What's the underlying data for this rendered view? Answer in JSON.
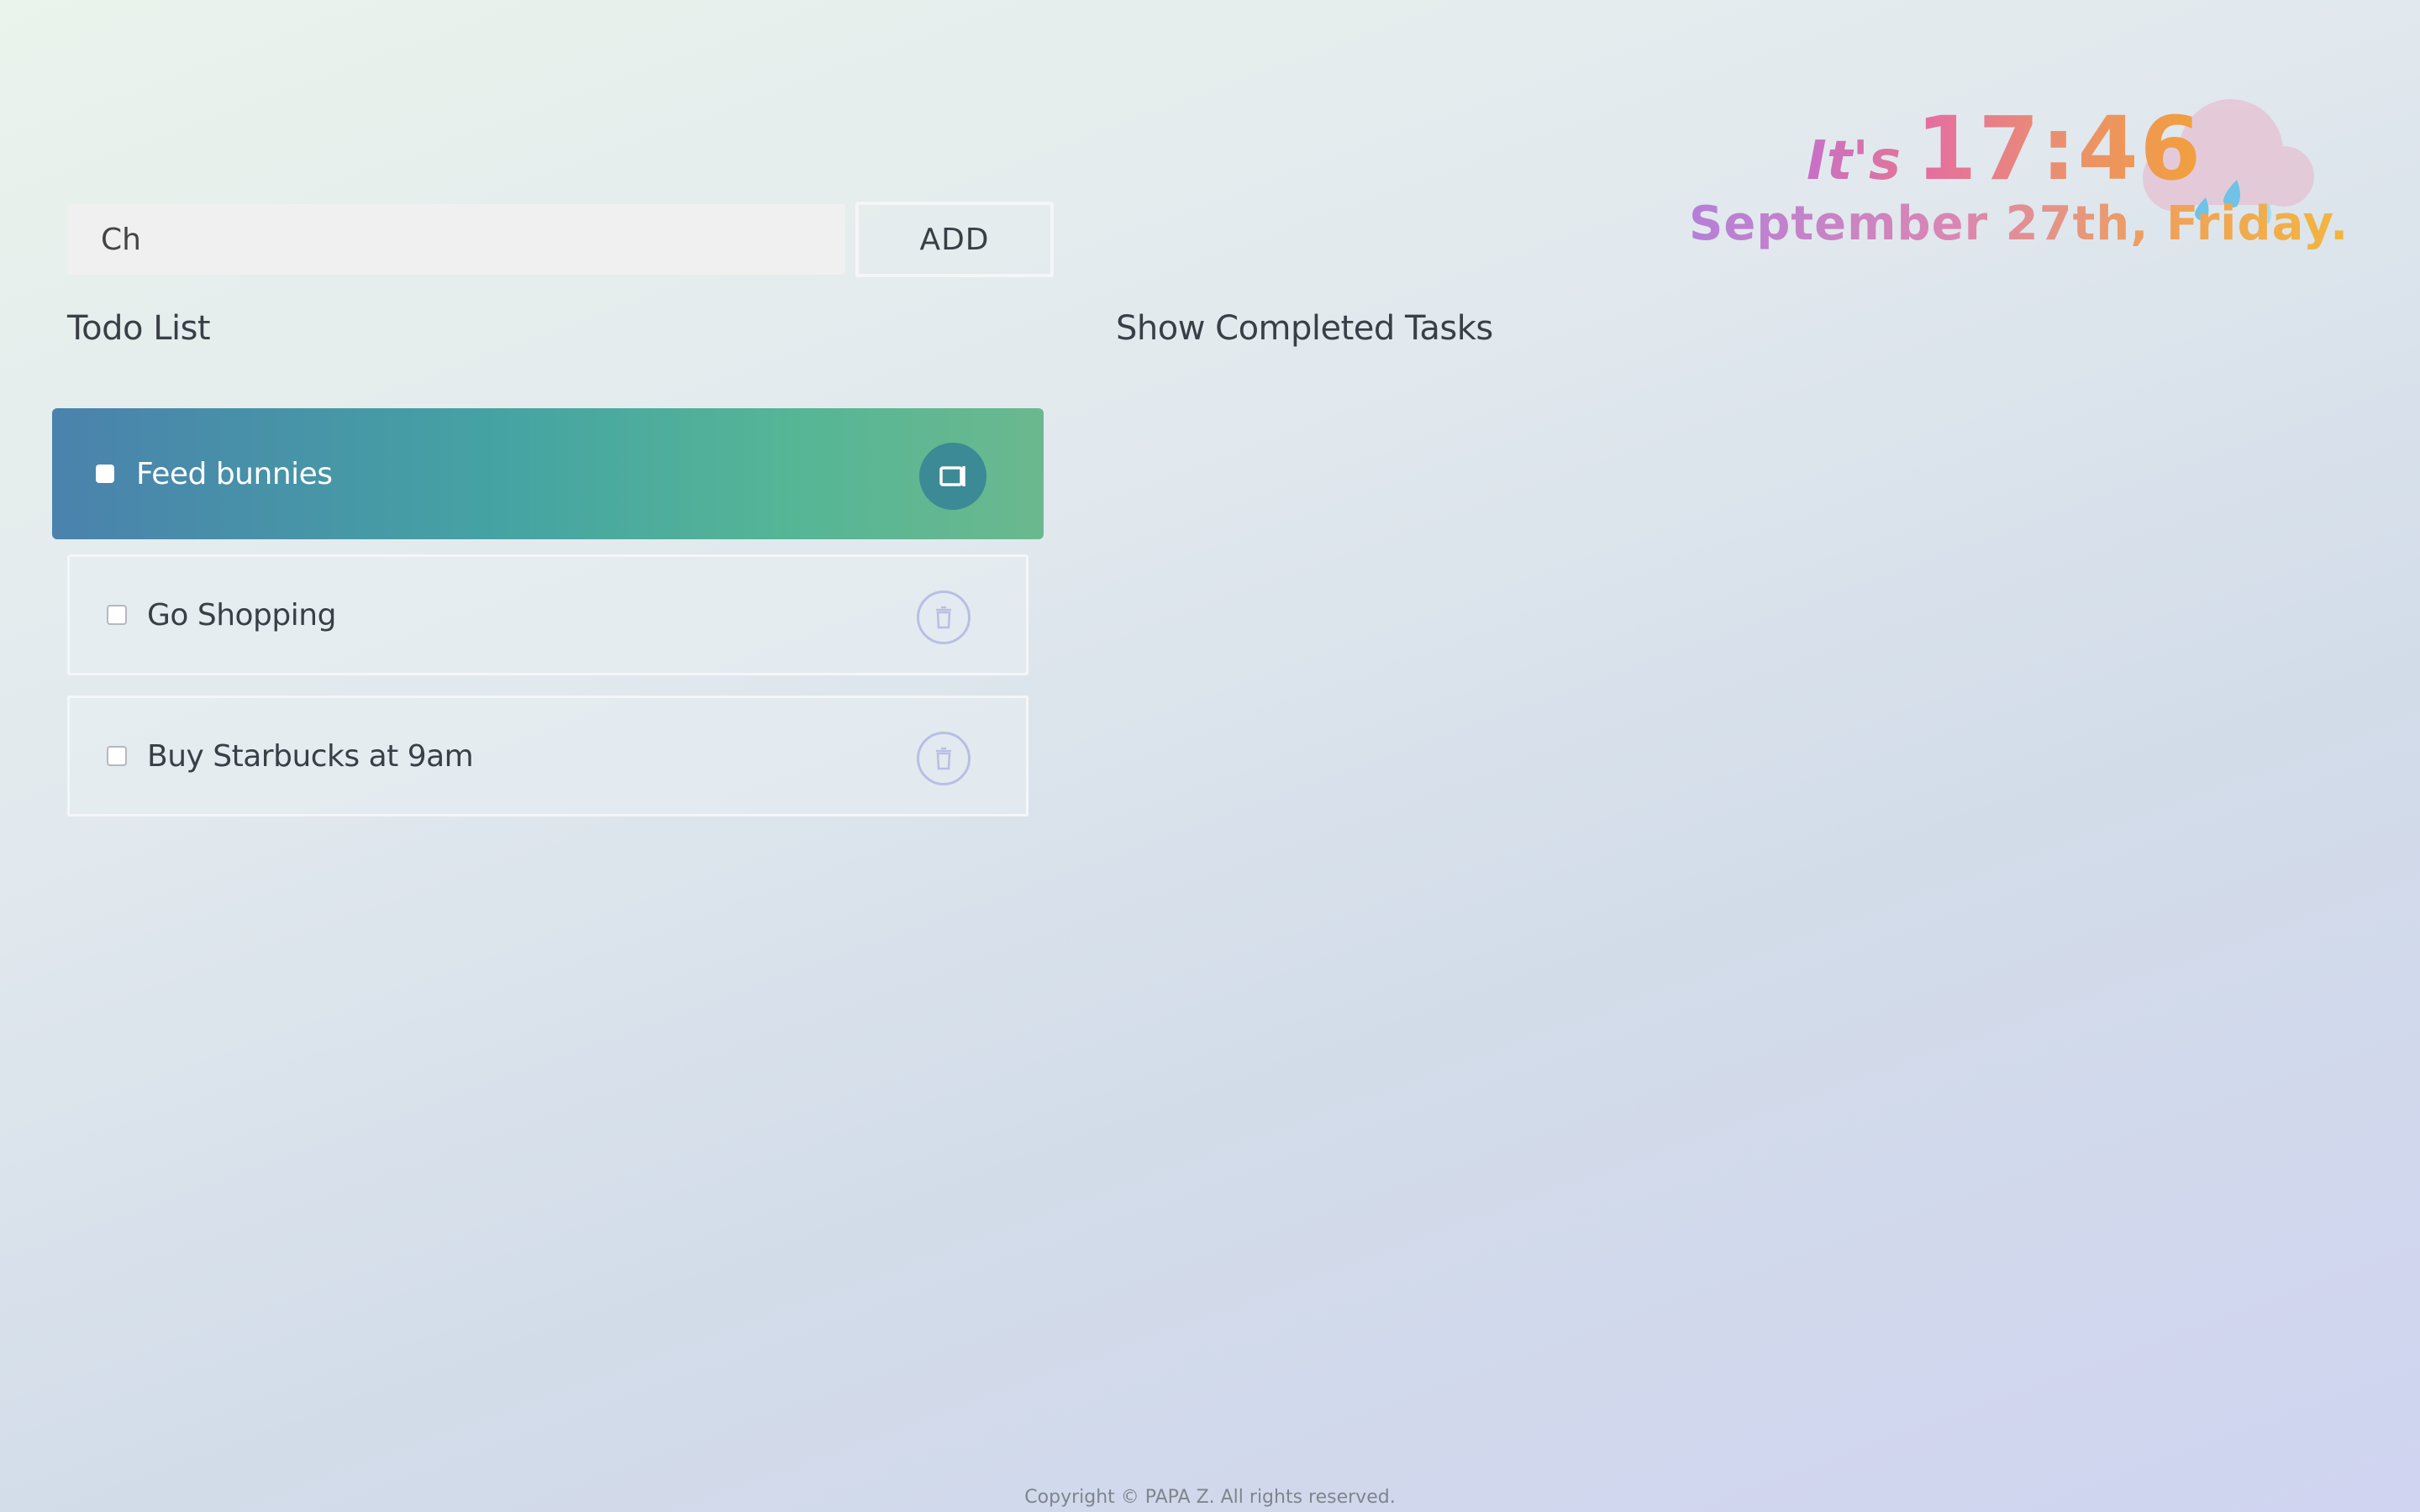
{
  "input": {
    "value": "Ch",
    "add_label": "ADD"
  },
  "todo_heading": "Todo List",
  "completed_toggle_label": "Show Completed Tasks",
  "tasks": [
    {
      "text": "Feed bunnies",
      "state": "active",
      "action_icon": "archive-icon"
    },
    {
      "text": "Go Shopping",
      "state": "normal",
      "action_icon": "trash-icon"
    },
    {
      "text": "Buy Starbucks at 9am",
      "state": "normal",
      "action_icon": "trash-icon"
    }
  ],
  "clock": {
    "prefix": "It's",
    "time": "17:46",
    "date": "September 27th, Friday.",
    "weather_icon": "rain-cloud-icon"
  },
  "footer": "Copyright © PAPA Z. All rights reserved.",
  "colors": {
    "active_gradient_start": "#4a82ad",
    "active_gradient_end": "#6bb88e",
    "active_action_bg": "#3c8a96",
    "trash_icon_stroke": "#b8bfe4",
    "text": "#3a3f47"
  }
}
